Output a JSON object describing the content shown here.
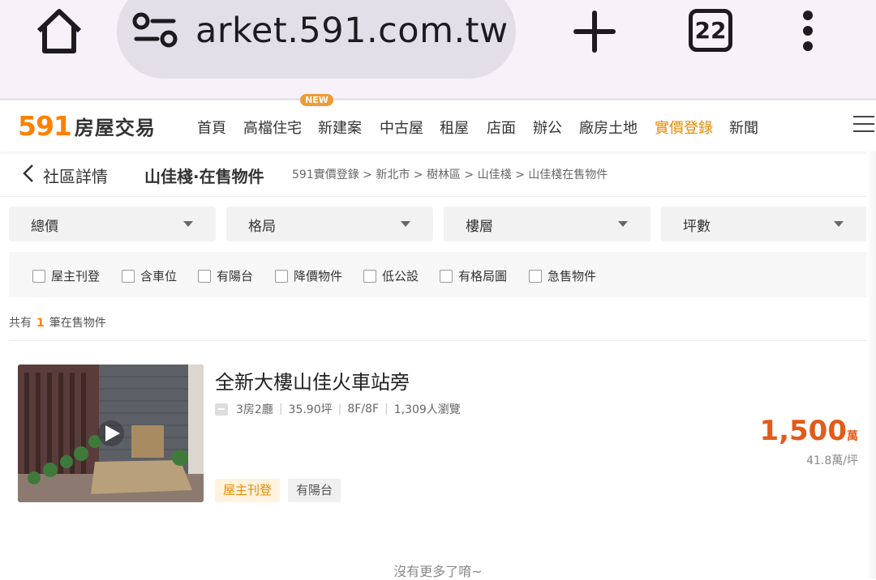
{
  "browser": {
    "url": "arket.591.com.tw",
    "tab_count": "22"
  },
  "site": {
    "logo_number": "591",
    "logo_text": "房屋交易",
    "new_badge": "NEW",
    "nav": [
      "首頁",
      "高檔住宅",
      "新建案",
      "中古屋",
      "租屋",
      "店面",
      "辦公",
      "廠房土地",
      "實價登錄",
      "新聞"
    ],
    "nav_active": "實價登錄"
  },
  "crumb": {
    "back_label": "社區詳情",
    "page_title": "山佳棧·在售物件",
    "path": "591實價登錄 > 新北市 > 樹林區 > 山佳棧 > 山佳棧在售物件"
  },
  "filters": [
    "總價",
    "格局",
    "樓層",
    "坪數"
  ],
  "checkboxes": [
    "屋主刊登",
    "含車位",
    "有陽台",
    "降價物件",
    "低公設",
    "有格局圖",
    "急售物件"
  ],
  "count": {
    "prefix": "共有",
    "number": "1",
    "suffix": "筆在售物件"
  },
  "listing": {
    "title": "全新大樓山佳火車站旁",
    "layout": "3房2廳",
    "size": "35.90坪",
    "floor": "8F/8F",
    "views": "1,309人瀏覽",
    "price": "1,500",
    "price_unit": "萬",
    "unit_price": "41.8萬/坪",
    "tags": [
      "屋主刊登",
      "有陽台"
    ]
  },
  "footer_note": "沒有更多了唷~",
  "colors": {
    "accent": "#ff8000",
    "price": "#e25b1a",
    "chrome_bg": "#f7f2fa"
  }
}
